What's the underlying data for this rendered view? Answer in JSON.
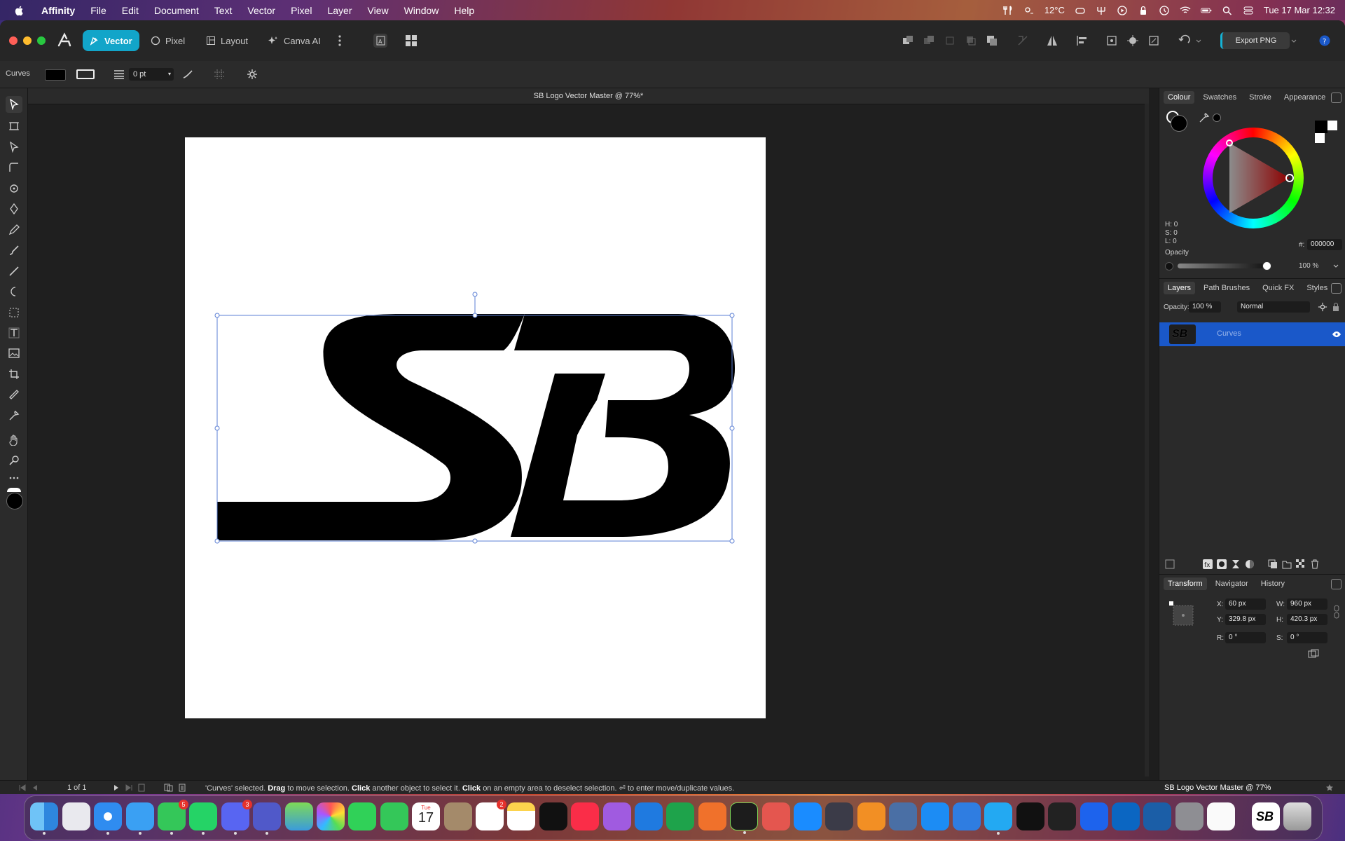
{
  "menubar": {
    "app_name": "Affinity",
    "items": [
      "File",
      "Edit",
      "Document",
      "Text",
      "Vector",
      "Pixel",
      "Layer",
      "View",
      "Window",
      "Help"
    ],
    "temperature": "12°C",
    "datetime": "Tue 17 Mar  12:32"
  },
  "personas": [
    {
      "label": "Vector",
      "active": true
    },
    {
      "label": "Pixel",
      "active": false
    },
    {
      "label": "Layout",
      "active": false
    },
    {
      "label": "Canva AI",
      "active": false
    }
  ],
  "toolbar": {
    "export_label": "Export PNG"
  },
  "context": {
    "selection_label": "Curves",
    "stroke_width": "0 pt"
  },
  "document": {
    "title": "SB Logo Vector Master @ 77%*",
    "logo_text": "SB"
  },
  "status": {
    "pages": "1 of 1",
    "hint_prefix": "'Curves' selected.",
    "hint_drag": "Drag",
    "hint_mid1": "to move selection.",
    "hint_click1": "Click",
    "hint_mid2": "another object to select it.",
    "hint_click2": "Click",
    "hint_mid3": "on an empty area to deselect selection.",
    "hint_end": "⏎ to enter move/duplicate values.",
    "doc_title": "SB Logo Vector Master @ 77%"
  },
  "colour_panel": {
    "tabs": [
      "Colour",
      "Swatches",
      "Stroke",
      "Appearance"
    ],
    "h": "H: 0",
    "s": "S: 0",
    "l": "L: 0",
    "hex_label": "#:",
    "hex_value": "000000",
    "opacity_label": "Opacity",
    "opacity_value": "100 %"
  },
  "layers_panel": {
    "tabs": [
      "Layers",
      "Path Brushes",
      "Quick FX",
      "Styles"
    ],
    "opacity_label": "Opacity:",
    "opacity_value": "100 %",
    "blend_mode": "Normal",
    "layer_name": "Curves"
  },
  "transform_panel": {
    "tabs": [
      "Transform",
      "Navigator",
      "History"
    ],
    "x_label": "X:",
    "x_value": "60 px",
    "y_label": "Y:",
    "y_value": "329.8 px",
    "w_label": "W:",
    "w_value": "960 px",
    "h_label": "H:",
    "h_value": "420.3 px",
    "r_label": "R:",
    "r_value": "0 °",
    "s_label": "S:",
    "s_value": "0 °"
  },
  "dock": {
    "badges": {
      "messages": "5",
      "discord": "3",
      "reminders": "2"
    },
    "calendar_day": "17",
    "calendar_month": "Tue"
  },
  "colors": {
    "accent": "#12a5c9",
    "selection_blue": "#1a58c9",
    "canvas_bg": "#1f1f1f"
  }
}
